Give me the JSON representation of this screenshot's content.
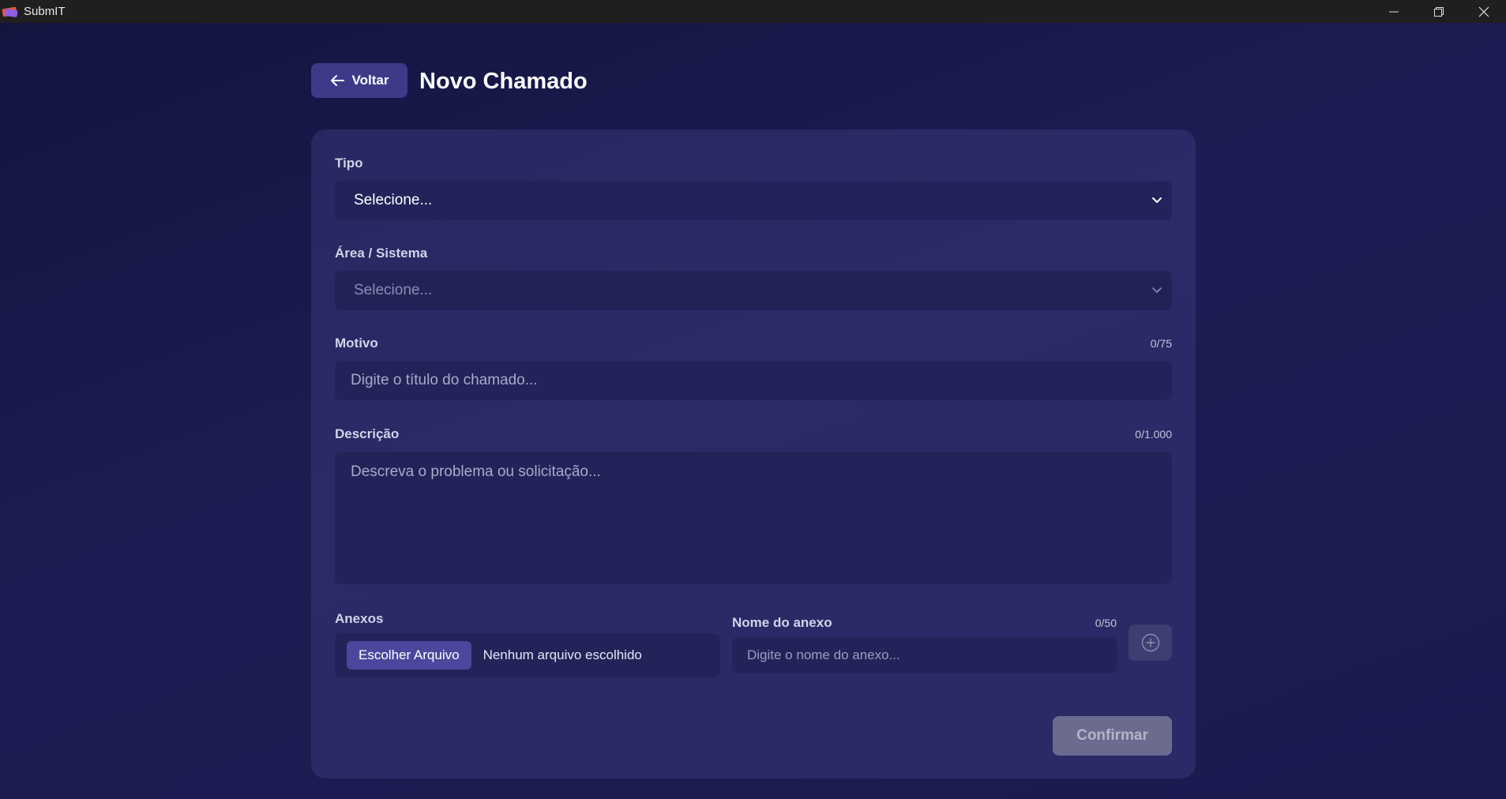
{
  "window": {
    "title": "SubmIT",
    "minimize_icon": "minimize-icon",
    "maximize_icon": "restore-icon",
    "close_icon": "close-icon"
  },
  "header": {
    "back_label": "Voltar",
    "back_icon": "arrow-left-icon",
    "title": "Novo Chamado"
  },
  "form": {
    "tipo": {
      "label": "Tipo",
      "selected": "Selecione..."
    },
    "area": {
      "label": "Área / Sistema",
      "selected": "Selecione..."
    },
    "motivo": {
      "label": "Motivo",
      "counter": "0/75",
      "placeholder": "Digite o título do chamado..."
    },
    "descricao": {
      "label": "Descrição",
      "counter": "0/1.000",
      "placeholder": "Descreva o problema ou solicitação..."
    },
    "anexos": {
      "label": "Anexos",
      "choose_label": "Escolher Arquivo",
      "file_status": "Nenhum arquivo escolhido"
    },
    "nome_anexo": {
      "label": "Nome do anexo",
      "counter": "0/50",
      "placeholder": "Digite o nome do anexo..."
    },
    "add_icon": "plus-circle-icon",
    "confirm_label": "Confirmar"
  },
  "colors": {
    "background": "#1a1b4f",
    "card": "#2b2c68",
    "accent": "#3d3a8a",
    "disabled_button": "#6a6b8e"
  }
}
